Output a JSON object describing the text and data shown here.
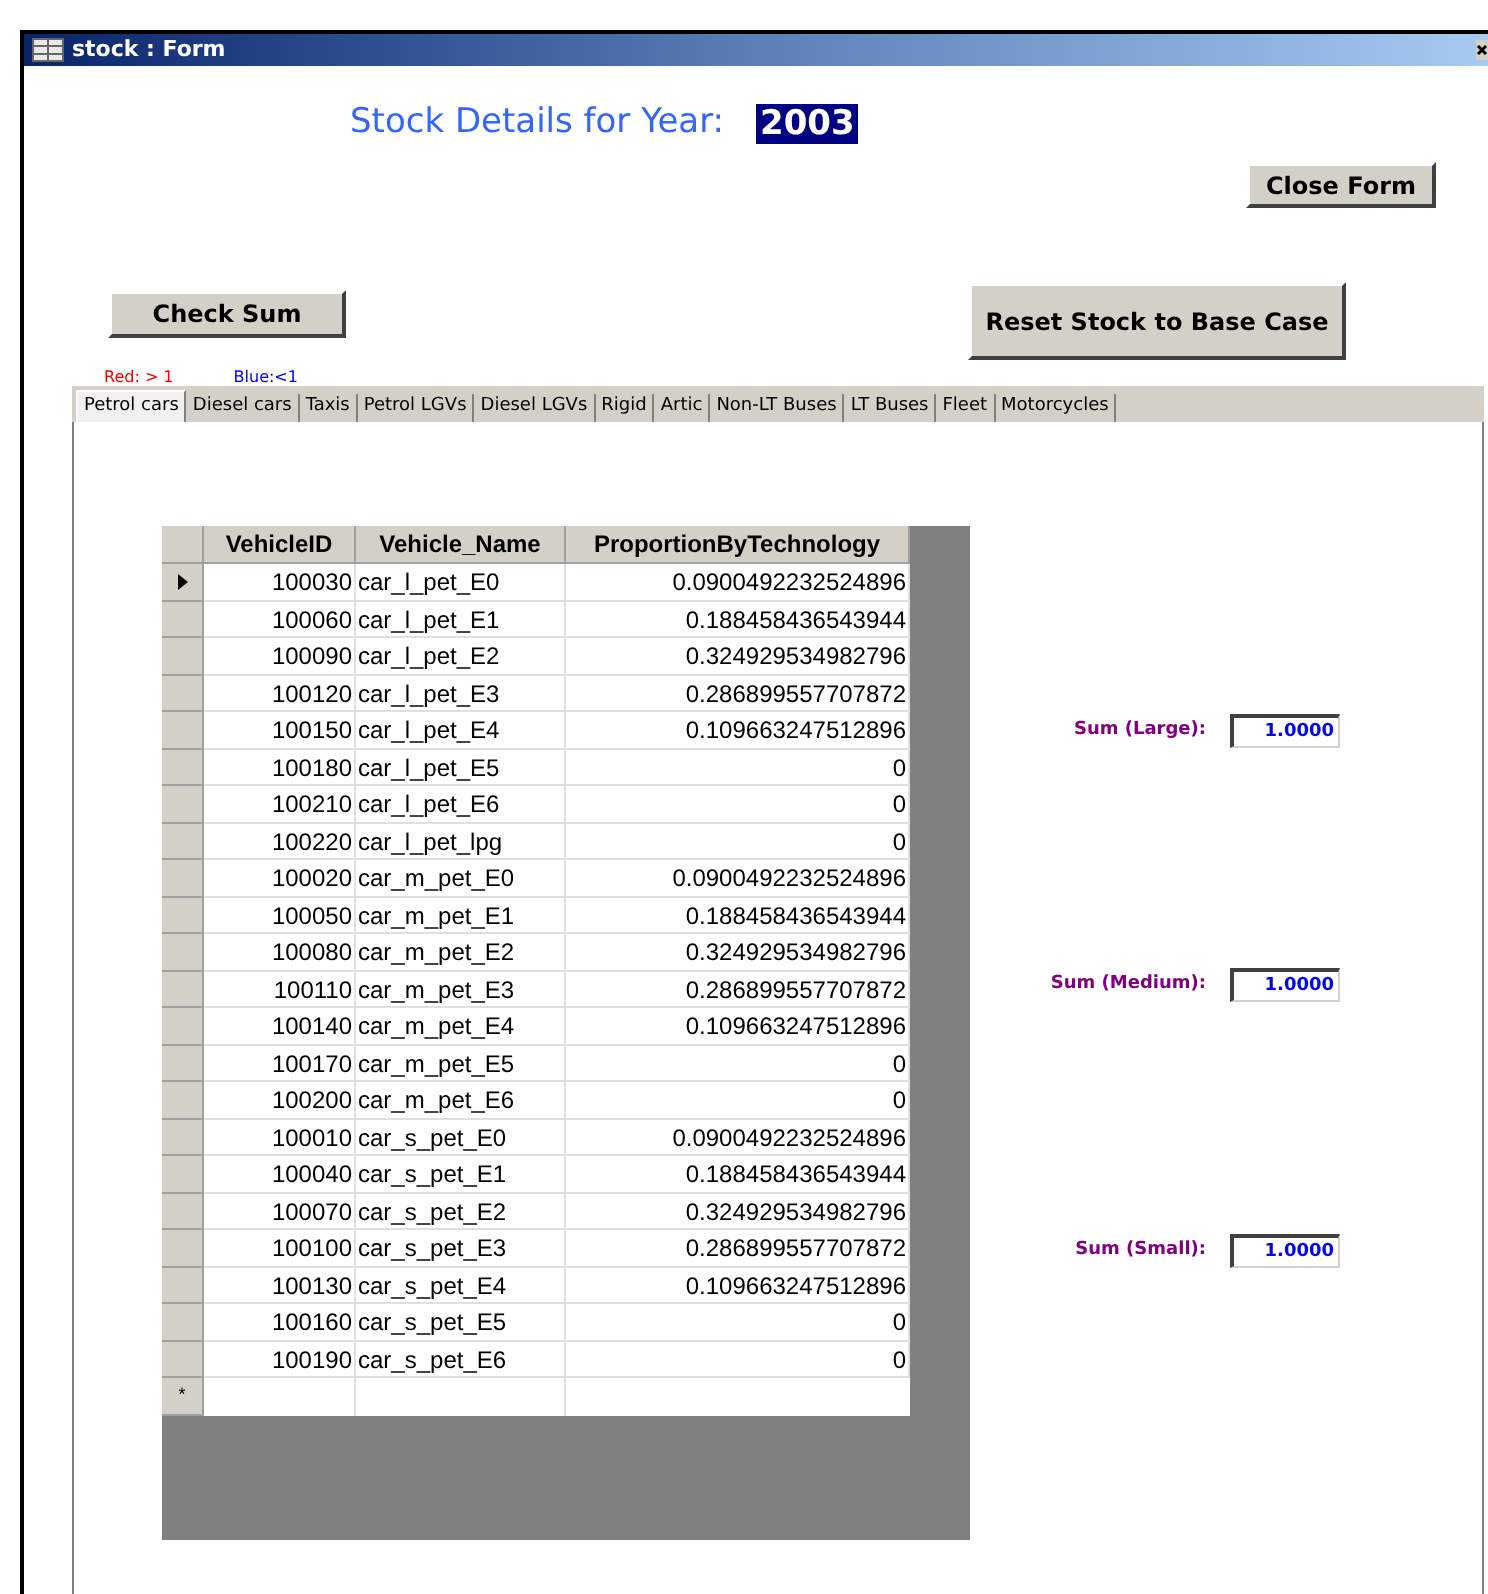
{
  "window": {
    "title": "stock : Form"
  },
  "header": {
    "label": "Stock Details for Year:",
    "year": "2003"
  },
  "buttons": {
    "close_form": "Close Form",
    "check_sum": "Check Sum",
    "reset": "Reset Stock to Base Case"
  },
  "legend": [
    {
      "text": "Red: > 1",
      "color": "#ff0000"
    },
    {
      "text": "Blue:<1",
      "color": "#0000ff"
    }
  ],
  "tabs": [
    {
      "label": "Petrol cars",
      "selected": true
    },
    {
      "label": "Diesel cars",
      "selected": false
    },
    {
      "label": "Taxis",
      "selected": false
    },
    {
      "label": "Petrol LGVs",
      "selected": false
    },
    {
      "label": "Diesel LGVs",
      "selected": false
    },
    {
      "label": "Rigid",
      "selected": false
    },
    {
      "label": "Artic",
      "selected": false
    },
    {
      "label": "Non-LT Buses",
      "selected": false
    },
    {
      "label": "LT Buses",
      "selected": false
    },
    {
      "label": "Fleet",
      "selected": false
    },
    {
      "label": "Motorcycles",
      "selected": false
    }
  ],
  "table": {
    "columns": [
      "VehicleID",
      "Vehicle_Name",
      "ProportionByTechnology"
    ],
    "rows": [
      {
        "cells": [
          "100030",
          "car_l_pet_E0",
          "0.0900492232524896"
        ],
        "selected": true
      },
      {
        "cells": [
          "100060",
          "car_l_pet_E1",
          "0.188458436543944"
        ],
        "selected": false
      },
      {
        "cells": [
          "100090",
          "car_l_pet_E2",
          "0.324929534982796"
        ],
        "selected": false
      },
      {
        "cells": [
          "100120",
          "car_l_pet_E3",
          "0.286899557707872"
        ],
        "selected": false
      },
      {
        "cells": [
          "100150",
          "car_l_pet_E4",
          "0.109663247512896"
        ],
        "selected": false
      },
      {
        "cells": [
          "100180",
          "car_l_pet_E5",
          "0"
        ],
        "selected": false
      },
      {
        "cells": [
          "100210",
          "car_l_pet_E6",
          "0"
        ],
        "selected": false
      },
      {
        "cells": [
          "100220",
          "car_l_pet_lpg",
          "0"
        ],
        "selected": false
      },
      {
        "cells": [
          "100020",
          "car_m_pet_E0",
          "0.0900492232524896"
        ],
        "selected": false
      },
      {
        "cells": [
          "100050",
          "car_m_pet_E1",
          "0.188458436543944"
        ],
        "selected": false
      },
      {
        "cells": [
          "100080",
          "car_m_pet_E2",
          "0.324929534982796"
        ],
        "selected": false
      },
      {
        "cells": [
          "100110",
          "car_m_pet_E3",
          "0.286899557707872"
        ],
        "selected": false
      },
      {
        "cells": [
          "100140",
          "car_m_pet_E4",
          "0.109663247512896"
        ],
        "selected": false
      },
      {
        "cells": [
          "100170",
          "car_m_pet_E5",
          "0"
        ],
        "selected": false
      },
      {
        "cells": [
          "100200",
          "car_m_pet_E6",
          "0"
        ],
        "selected": false
      },
      {
        "cells": [
          "100010",
          "car_s_pet_E0",
          "0.0900492232524896"
        ],
        "selected": false
      },
      {
        "cells": [
          "100040",
          "car_s_pet_E1",
          "0.188458436543944"
        ],
        "selected": false
      },
      {
        "cells": [
          "100070",
          "car_s_pet_E2",
          "0.324929534982796"
        ],
        "selected": false
      },
      {
        "cells": [
          "100100",
          "car_s_pet_E3",
          "0.286899557707872"
        ],
        "selected": false
      },
      {
        "cells": [
          "100130",
          "car_s_pet_E4",
          "0.109663247512896"
        ],
        "selected": false
      },
      {
        "cells": [
          "100160",
          "car_s_pet_E5",
          "0"
        ],
        "selected": false
      },
      {
        "cells": [
          "100190",
          "car_s_pet_E6",
          "0"
        ],
        "selected": false
      }
    ],
    "new_row_marker": "*"
  },
  "sums": [
    {
      "label": "Sum (Large):",
      "value": "1.0000"
    },
    {
      "label": "Sum (Medium):",
      "value": "1.0000"
    },
    {
      "label": "Sum (Small):",
      "value": "1.0000"
    }
  ]
}
